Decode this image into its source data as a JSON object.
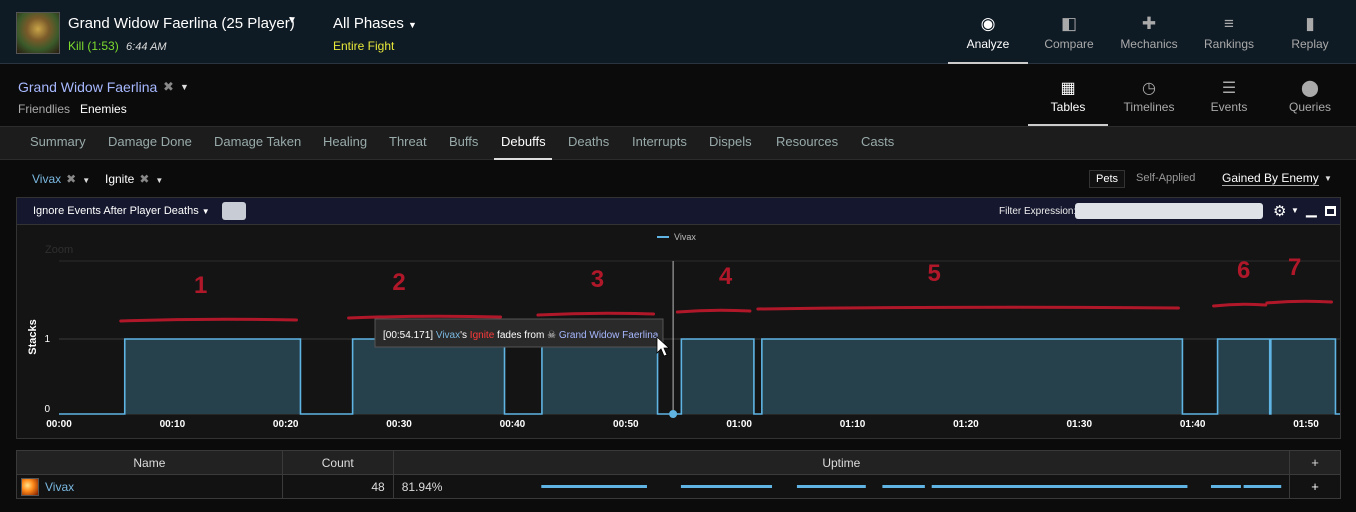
{
  "header": {
    "boss_name": "Grand Widow Faerlina (25 Player)",
    "kill_text": "Kill (1:53)",
    "kill_time": "6:44 AM",
    "phase": "All Phases",
    "phase_sub": "Entire Fight",
    "nav": [
      {
        "label": "Analyze",
        "icon": "eye-icon"
      },
      {
        "label": "Compare",
        "icon": "compare-icon"
      },
      {
        "label": "Mechanics",
        "icon": "puzzle-icon"
      },
      {
        "label": "Rankings",
        "icon": "rankings-icon"
      },
      {
        "label": "Replay",
        "icon": "film-icon"
      }
    ]
  },
  "subheader": {
    "target": "Grand Widow Faerlina",
    "friendlies": "Friendlies",
    "enemies": "Enemies",
    "views": [
      {
        "label": "Tables",
        "icon": "grid-icon"
      },
      {
        "label": "Timelines",
        "icon": "clock-icon"
      },
      {
        "label": "Events",
        "icon": "list-icon"
      },
      {
        "label": "Queries",
        "icon": "pin-icon"
      }
    ]
  },
  "tabs": [
    "Summary",
    "Damage Done",
    "Damage Taken",
    "Healing",
    "Threat",
    "Buffs",
    "Debuffs",
    "Deaths",
    "Interrupts",
    "Dispels",
    "Resources",
    "Casts"
  ],
  "active_tab": "Debuffs",
  "filters": {
    "source": "Vivax",
    "ability": "Ignite",
    "pets": "Pets",
    "self_applied": "Self-Applied",
    "gained_by": "Gained By Enemy"
  },
  "panel": {
    "ignore_label": "Ignore Events After Player Deaths",
    "filter_label": "Filter Expression:"
  },
  "tooltip": {
    "time": "[00:54.171]",
    "actor": "Vivax",
    "possessive": "'s",
    "spell": "Ignite",
    "verb": "fades from",
    "target": "Grand Widow Faerlina"
  },
  "chart_data": {
    "type": "area",
    "ylabel": "Stacks",
    "zoom_label": "Zoom",
    "legend": [
      "Vivax"
    ],
    "legend_placement": "top-center",
    "y_ticks": [
      "0",
      "1"
    ],
    "ylim": [
      0,
      2
    ],
    "x_ticks": [
      "00:00",
      "00:10",
      "00:20",
      "00:30",
      "00:40",
      "00:50",
      "01:00",
      "01:10",
      "01:20",
      "01:30",
      "01:40",
      "01:50"
    ],
    "xlim_seconds": [
      0,
      113
    ],
    "segments_seconds": [
      [
        5.8,
        21.3
      ],
      [
        25.9,
        39.3
      ],
      [
        42.6,
        52.8
      ],
      [
        54.9,
        61.3
      ],
      [
        62.0,
        99.1
      ],
      [
        102.2,
        106.8
      ],
      [
        106.9,
        112.6
      ]
    ],
    "value": 1,
    "marker_seconds": 54.171,
    "annotations": [
      {
        "label": "1",
        "time": 12.5
      },
      {
        "label": "2",
        "time": 30.0
      },
      {
        "label": "3",
        "time": 47.5
      },
      {
        "label": "4",
        "time": 58.8
      },
      {
        "label": "5",
        "time": 77.2
      },
      {
        "label": "6",
        "time": 104.5
      },
      {
        "label": "7",
        "time": 109.0
      }
    ],
    "colors": {
      "series": "#5fb4e3",
      "fill": "#26404c",
      "annotation": "#b0182a"
    }
  },
  "table": {
    "headers": [
      "Name",
      "Count",
      "Uptime",
      "+"
    ],
    "rows": [
      {
        "name": "Vivax",
        "count": "48",
        "uptime": "81.94%",
        "add": "+"
      }
    ]
  }
}
